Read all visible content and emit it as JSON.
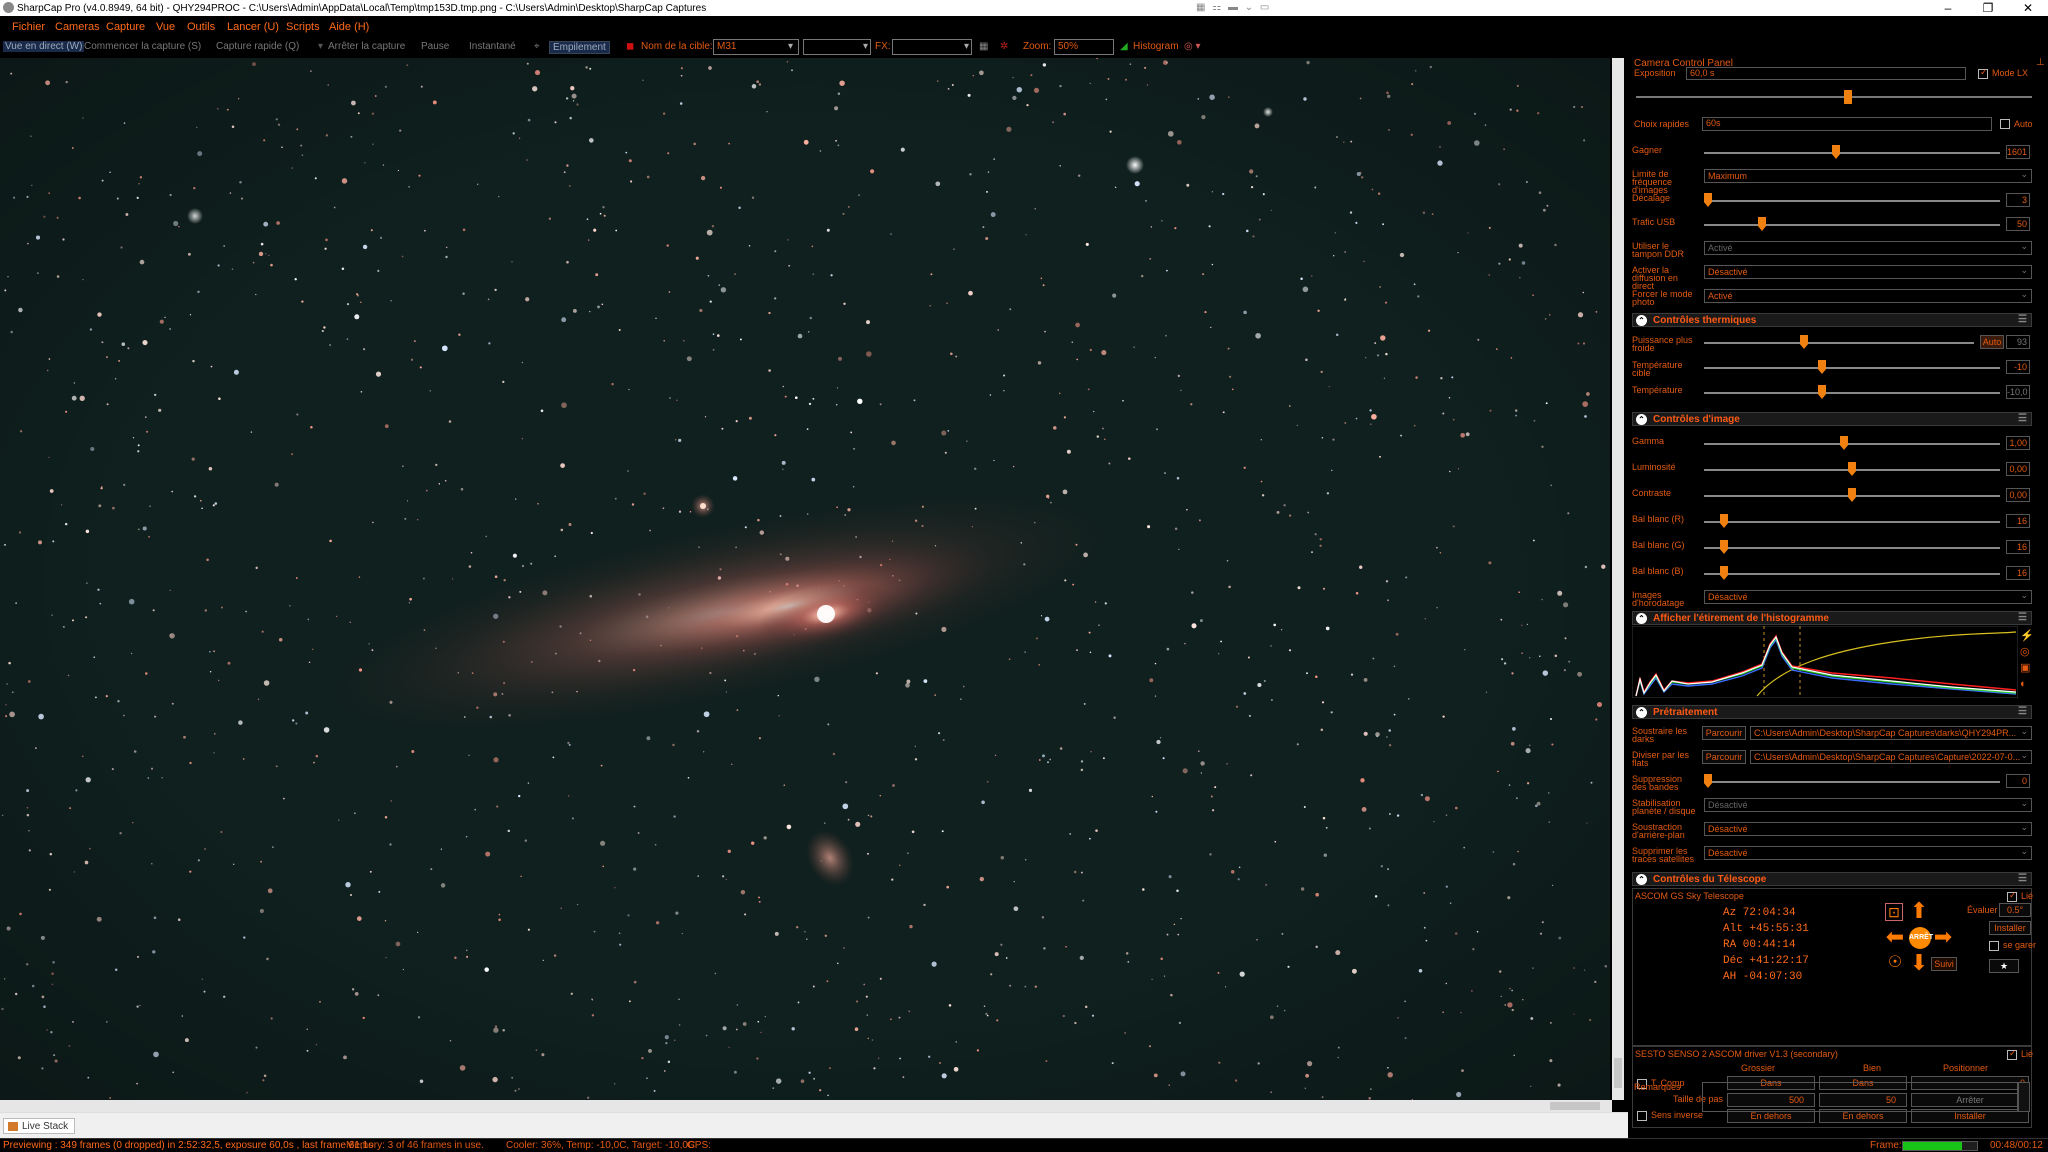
{
  "window": {
    "title": "SharpCap Pro (v4.0.8949, 64 bit) - QHY294PROC - C:\\Users\\Admin\\AppData\\Local\\Temp\\tmp153D.tmp.png - C:\\Users\\Admin\\Desktop\\SharpCap Captures",
    "minimize": "–",
    "maximize": "❐",
    "close": "✕"
  },
  "menu": [
    "Fichier",
    "Cameras",
    "Capture",
    "Vue",
    "Outils",
    "Lancer (U)",
    "Scripts",
    "Aide (H)"
  ],
  "toolbar": {
    "live_view": "Vue en direct (W)",
    "start_capture": "Commencer la capture (S)",
    "quick_capture": "Capture rapide (Q)",
    "stop_capture": "Arrêter la capture",
    "pause": "Pause",
    "snapshot": "Instantané",
    "stacking": "Empilement",
    "target_label": "Nom de la cible:",
    "target_value": "M31",
    "fx_label": "FX:",
    "zoom_label": "Zoom:",
    "zoom_value": "50%",
    "histogram": "Histogram"
  },
  "panel": {
    "title": "Camera Control Panel",
    "exposure_label": "Exposition",
    "exposure_value": "60,0 s",
    "lx_mode": "Mode LX",
    "quick_label": "Choix rapides",
    "quick_value": "60s",
    "auto": "Auto",
    "gain_label": "Gagner",
    "gain_value": "1601",
    "frame_rate_label": "Limite de fréquence d'images",
    "frame_rate_value": "Maximum",
    "offset_label": "Décalage",
    "offset_value": "3",
    "usb_label": "Trafic USB",
    "usb_value": "50",
    "ddr_label": "Utiliser le tampon DDR",
    "ddr_value": "Activé",
    "stream_label": "Activer la diffusion en direct",
    "stream_value": "Désactivé",
    "photo_label": "Forcer le mode photo",
    "photo_value": "Activé",
    "thermal_head": "Contrôles thermiques",
    "cooler_label": "Puissance plus froide",
    "cooler_auto": "Auto",
    "cooler_value": "93",
    "target_temp_label": "Température cible",
    "target_temp_value": "-10",
    "temp_label": "Température",
    "temp_value": "-10,0",
    "image_head": "Contrôles d'image",
    "gamma_label": "Gamma",
    "gamma_value": "1,00",
    "brightness_label": "Luminosité",
    "brightness_value": "0,00",
    "contrast_label": "Contraste",
    "contrast_value": "0,00",
    "wbr_label": "Bal blanc (R)",
    "wbr_value": "16",
    "wbg_label": "Bal blanc (G)",
    "wbg_value": "16",
    "wbb_label": "Bal blanc (B)",
    "wbb_value": "16",
    "timestamp_label": "Images d'horodatage",
    "timestamp_value": "Désactivé",
    "histo_head": "Afficher l'étirement de l'histogramme",
    "pre_head": "Prétraitement",
    "darks_label": "Soustraire les darks",
    "browse": "Parcourir",
    "darks_path": "C:\\Users\\Admin\\Desktop\\SharpCap Captures\\darks\\QHY294PR...",
    "flats_label": "Diviser par les flats",
    "flats_path": "C:\\Users\\Admin\\Desktop\\SharpCap Captures\\Capture\\2022-07-0...",
    "banding_label": "Suppression des bandes",
    "banding_value": "0",
    "stab_label": "Stabilisation planète / disque",
    "stab_value": "Désactivé",
    "bg_label": "Soustraction d'arrière-plan",
    "bg_value": "Désactivé",
    "sat_label": "Supprimer les traces satellites",
    "sat_value": "Désactivé",
    "tel_head": "Contrôles du Télescope",
    "tel_name": "ASCOM GS Sky Telescope",
    "linked": "Lié",
    "az": "Az    72:04:34",
    "alt": "Alt  +45:55:31",
    "ra": "RA    00:44:14",
    "dec": "Déc  +41:22:17",
    "ah": "AH   -04:07:30",
    "eval_label": "Évaluer",
    "eval_value": "0.5°",
    "install": "Installer",
    "park": "se garer",
    "follow": "Suivi",
    "stop_label": "ARRÊT",
    "focuser_name": "SESTO SENSO 2 ASCOM driver V1.3 (secondary)",
    "coarse": "Grossier",
    "fine": "Bien",
    "position": "Positionner",
    "tcomp": "T. Comp",
    "in": "Dans",
    "position_value": "0",
    "step_label": "Taille de pas",
    "step_coarse": "500",
    "step_fine": "50",
    "stop": "Arrêter",
    "reverse": "Sens inverse",
    "out": "En dehors",
    "remarks": "Remarques"
  },
  "tab": "Live Stack",
  "status": {
    "preview": "Previewing : 349 frames (0 dropped) in 2:52:32,5, exposure 60,0s , last frame 61,1s",
    "memory": "Memory: 3 of 46 frames in use.",
    "cooler": "Cooler: 36%, Temp: -10,0C, Target: -10,0C",
    "gps": "GPS:",
    "frame_label": "Frame:",
    "frame_progress": 0.8,
    "time": "00:48/00:12"
  },
  "colors": {
    "accent": "#e35a12",
    "sky": "#0d1e1c"
  }
}
